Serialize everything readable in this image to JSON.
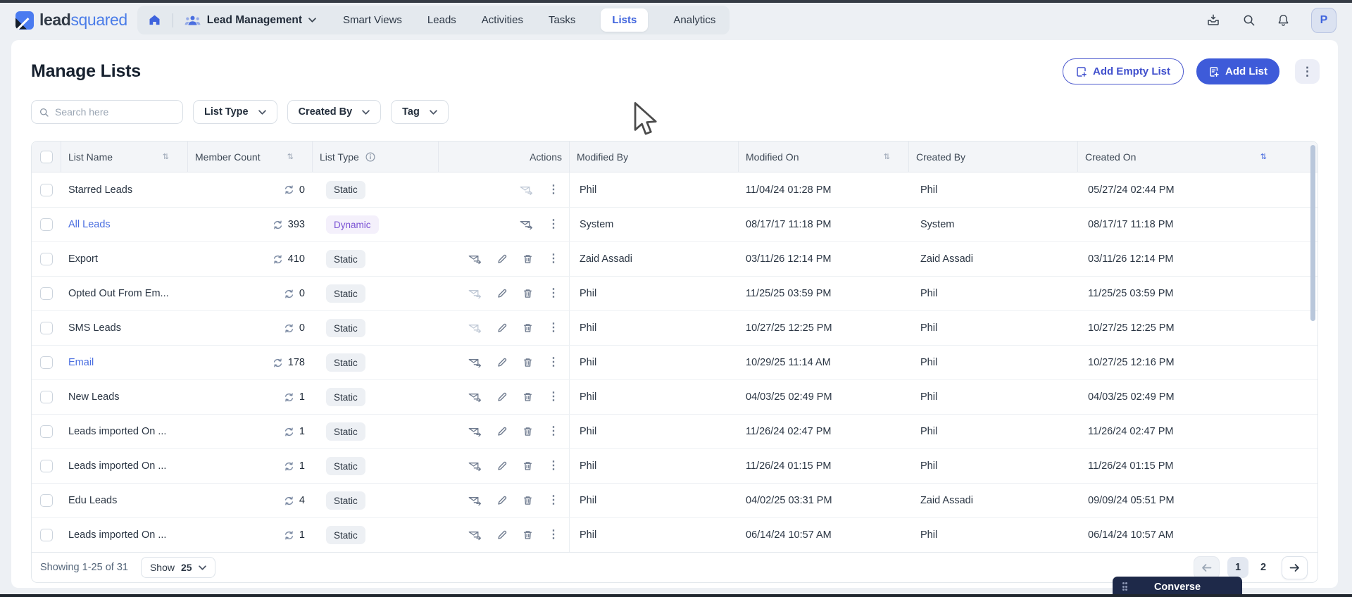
{
  "topbar": {
    "logo_lead": "lead",
    "logo_squared": "squared",
    "workspace_label": "Lead Management",
    "tabs": [
      {
        "label": "Smart Views",
        "active": false
      },
      {
        "label": "Leads",
        "active": false
      },
      {
        "label": "Activities",
        "active": false
      },
      {
        "label": "Tasks",
        "active": false
      },
      {
        "label": "Lists",
        "active": true
      },
      {
        "label": "Analytics",
        "active": false
      }
    ],
    "avatar_initial": "P"
  },
  "page": {
    "title": "Manage Lists",
    "add_empty_list_label": "Add Empty List",
    "add_list_label": "Add List"
  },
  "filters": {
    "search_placeholder": "Search here",
    "dropdowns": [
      {
        "label": "List Type"
      },
      {
        "label": "Created By"
      },
      {
        "label": "Tag"
      }
    ]
  },
  "table": {
    "columns": {
      "list_name": "List Name",
      "member_count": "Member Count",
      "list_type": "List Type",
      "actions": "Actions",
      "modified_by": "Modified By",
      "modified_on": "Modified On",
      "created_by": "Created By",
      "created_on": "Created On"
    },
    "rows": [
      {
        "name": "Starred Leads",
        "name_link": false,
        "member_count": "0",
        "list_type": "Static",
        "actions": [
          "mail-disabled",
          "kebab"
        ],
        "modified_by": "Phil",
        "modified_on": "11/04/24 01:28 PM",
        "created_by": "Phil",
        "created_on": "05/27/24 02:44 PM"
      },
      {
        "name": "All Leads",
        "name_link": true,
        "member_count": "393",
        "list_type": "Dynamic",
        "actions": [
          "mail",
          "kebab"
        ],
        "modified_by": "System",
        "modified_on": "08/17/17 11:18 PM",
        "created_by": "System",
        "created_on": "08/17/17 11:18 PM"
      },
      {
        "name": "Export",
        "name_link": false,
        "member_count": "410",
        "list_type": "Static",
        "actions": [
          "mail",
          "edit",
          "delete",
          "kebab"
        ],
        "modified_by": "Zaid Assadi",
        "modified_on": "03/11/26 12:14 PM",
        "created_by": "Zaid Assadi",
        "created_on": "03/11/26 12:14 PM"
      },
      {
        "name": "Opted Out From Em...",
        "name_link": false,
        "member_count": "0",
        "list_type": "Static",
        "actions": [
          "mail-disabled",
          "edit",
          "delete",
          "kebab"
        ],
        "modified_by": "Phil",
        "modified_on": "11/25/25 03:59 PM",
        "created_by": "Phil",
        "created_on": "11/25/25 03:59 PM"
      },
      {
        "name": "SMS Leads",
        "name_link": false,
        "member_count": "0",
        "list_type": "Static",
        "actions": [
          "mail-disabled",
          "edit",
          "delete",
          "kebab"
        ],
        "modified_by": "Phil",
        "modified_on": "10/27/25 12:25 PM",
        "created_by": "Phil",
        "created_on": "10/27/25 12:25 PM"
      },
      {
        "name": "Email",
        "name_link": true,
        "member_count": "178",
        "list_type": "Static",
        "actions": [
          "mail",
          "edit",
          "delete",
          "kebab"
        ],
        "modified_by": "Phil",
        "modified_on": "10/29/25 11:14 AM",
        "created_by": "Phil",
        "created_on": "10/27/25 12:16 PM"
      },
      {
        "name": "New Leads",
        "name_link": false,
        "member_count": "1",
        "list_type": "Static",
        "actions": [
          "mail",
          "edit",
          "delete",
          "kebab"
        ],
        "modified_by": "Phil",
        "modified_on": "04/03/25 02:49 PM",
        "created_by": "Phil",
        "created_on": "04/03/25 02:49 PM"
      },
      {
        "name": "Leads imported On ...",
        "name_link": false,
        "member_count": "1",
        "list_type": "Static",
        "actions": [
          "mail",
          "edit",
          "delete",
          "kebab"
        ],
        "modified_by": "Phil",
        "modified_on": "11/26/24 02:47 PM",
        "created_by": "Phil",
        "created_on": "11/26/24 02:47 PM"
      },
      {
        "name": "Leads imported On ...",
        "name_link": false,
        "member_count": "1",
        "list_type": "Static",
        "actions": [
          "mail",
          "edit",
          "delete",
          "kebab"
        ],
        "modified_by": "Phil",
        "modified_on": "11/26/24 01:15 PM",
        "created_by": "Phil",
        "created_on": "11/26/24 01:15 PM"
      },
      {
        "name": "Edu Leads",
        "name_link": false,
        "member_count": "4",
        "list_type": "Static",
        "actions": [
          "mail",
          "edit",
          "delete",
          "kebab"
        ],
        "modified_by": "Phil",
        "modified_on": "04/02/25 03:31 PM",
        "created_by": "Zaid Assadi",
        "created_on": "09/09/24 05:51 PM"
      },
      {
        "name": "Leads imported On ...",
        "name_link": false,
        "member_count": "1",
        "list_type": "Static",
        "actions": [
          "mail",
          "edit",
          "delete",
          "kebab"
        ],
        "modified_by": "Phil",
        "modified_on": "06/14/24 10:57 AM",
        "created_by": "Phil",
        "created_on": "06/14/24 10:57 AM"
      }
    ]
  },
  "footer": {
    "showing_text": "Showing 1-25 of 31",
    "show_label": "Show",
    "show_value": "25",
    "pages": [
      "1",
      "2"
    ],
    "active_page": "1"
  },
  "converse_label": "Converse",
  "colors": {
    "accent_blue": "#3e5bd9",
    "link_blue": "#4a6ee0",
    "dynamic_purple": "#7a52d4",
    "static_badge_bg": "#edf0f4",
    "dynamic_badge_bg": "#f4f0fb",
    "topbar_bg": "#edf0f4",
    "navy_converse": "#1e2949"
  }
}
